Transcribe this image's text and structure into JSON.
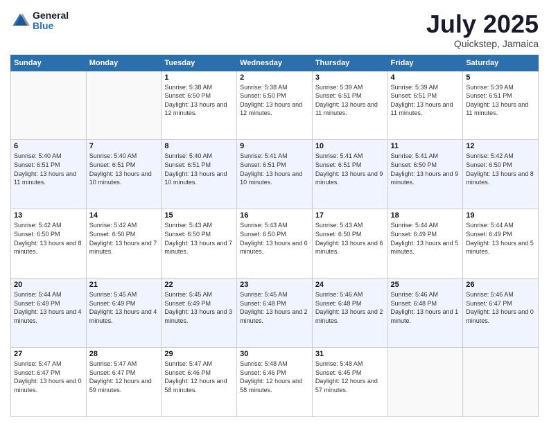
{
  "logo": {
    "text_general": "General",
    "text_blue": "Blue"
  },
  "header": {
    "month": "July 2025",
    "location": "Quickstep, Jamaica"
  },
  "weekdays": [
    "Sunday",
    "Monday",
    "Tuesday",
    "Wednesday",
    "Thursday",
    "Friday",
    "Saturday"
  ],
  "weeks": [
    [
      {
        "day": "",
        "sunrise": "",
        "sunset": "",
        "daylight": ""
      },
      {
        "day": "",
        "sunrise": "",
        "sunset": "",
        "daylight": ""
      },
      {
        "day": "1",
        "sunrise": "Sunrise: 5:38 AM",
        "sunset": "Sunset: 6:50 PM",
        "daylight": "Daylight: 13 hours and 12 minutes."
      },
      {
        "day": "2",
        "sunrise": "Sunrise: 5:38 AM",
        "sunset": "Sunset: 6:50 PM",
        "daylight": "Daylight: 13 hours and 12 minutes."
      },
      {
        "day": "3",
        "sunrise": "Sunrise: 5:39 AM",
        "sunset": "Sunset: 6:51 PM",
        "daylight": "Daylight: 13 hours and 11 minutes."
      },
      {
        "day": "4",
        "sunrise": "Sunrise: 5:39 AM",
        "sunset": "Sunset: 6:51 PM",
        "daylight": "Daylight: 13 hours and 11 minutes."
      },
      {
        "day": "5",
        "sunrise": "Sunrise: 5:39 AM",
        "sunset": "Sunset: 6:51 PM",
        "daylight": "Daylight: 13 hours and 11 minutes."
      }
    ],
    [
      {
        "day": "6",
        "sunrise": "Sunrise: 5:40 AM",
        "sunset": "Sunset: 6:51 PM",
        "daylight": "Daylight: 13 hours and 11 minutes."
      },
      {
        "day": "7",
        "sunrise": "Sunrise: 5:40 AM",
        "sunset": "Sunset: 6:51 PM",
        "daylight": "Daylight: 13 hours and 10 minutes."
      },
      {
        "day": "8",
        "sunrise": "Sunrise: 5:40 AM",
        "sunset": "Sunset: 6:51 PM",
        "daylight": "Daylight: 13 hours and 10 minutes."
      },
      {
        "day": "9",
        "sunrise": "Sunrise: 5:41 AM",
        "sunset": "Sunset: 6:51 PM",
        "daylight": "Daylight: 13 hours and 10 minutes."
      },
      {
        "day": "10",
        "sunrise": "Sunrise: 5:41 AM",
        "sunset": "Sunset: 6:51 PM",
        "daylight": "Daylight: 13 hours and 9 minutes."
      },
      {
        "day": "11",
        "sunrise": "Sunrise: 5:41 AM",
        "sunset": "Sunset: 6:50 PM",
        "daylight": "Daylight: 13 hours and 9 minutes."
      },
      {
        "day": "12",
        "sunrise": "Sunrise: 5:42 AM",
        "sunset": "Sunset: 6:50 PM",
        "daylight": "Daylight: 13 hours and 8 minutes."
      }
    ],
    [
      {
        "day": "13",
        "sunrise": "Sunrise: 5:42 AM",
        "sunset": "Sunset: 6:50 PM",
        "daylight": "Daylight: 13 hours and 8 minutes."
      },
      {
        "day": "14",
        "sunrise": "Sunrise: 5:42 AM",
        "sunset": "Sunset: 6:50 PM",
        "daylight": "Daylight: 13 hours and 7 minutes."
      },
      {
        "day": "15",
        "sunrise": "Sunrise: 5:43 AM",
        "sunset": "Sunset: 6:50 PM",
        "daylight": "Daylight: 13 hours and 7 minutes."
      },
      {
        "day": "16",
        "sunrise": "Sunrise: 5:43 AM",
        "sunset": "Sunset: 6:50 PM",
        "daylight": "Daylight: 13 hours and 6 minutes."
      },
      {
        "day": "17",
        "sunrise": "Sunrise: 5:43 AM",
        "sunset": "Sunset: 6:50 PM",
        "daylight": "Daylight: 13 hours and 6 minutes."
      },
      {
        "day": "18",
        "sunrise": "Sunrise: 5:44 AM",
        "sunset": "Sunset: 6:49 PM",
        "daylight": "Daylight: 13 hours and 5 minutes."
      },
      {
        "day": "19",
        "sunrise": "Sunrise: 5:44 AM",
        "sunset": "Sunset: 6:49 PM",
        "daylight": "Daylight: 13 hours and 5 minutes."
      }
    ],
    [
      {
        "day": "20",
        "sunrise": "Sunrise: 5:44 AM",
        "sunset": "Sunset: 6:49 PM",
        "daylight": "Daylight: 13 hours and 4 minutes."
      },
      {
        "day": "21",
        "sunrise": "Sunrise: 5:45 AM",
        "sunset": "Sunset: 6:49 PM",
        "daylight": "Daylight: 13 hours and 4 minutes."
      },
      {
        "day": "22",
        "sunrise": "Sunrise: 5:45 AM",
        "sunset": "Sunset: 6:49 PM",
        "daylight": "Daylight: 13 hours and 3 minutes."
      },
      {
        "day": "23",
        "sunrise": "Sunrise: 5:45 AM",
        "sunset": "Sunset: 6:48 PM",
        "daylight": "Daylight: 13 hours and 2 minutes."
      },
      {
        "day": "24",
        "sunrise": "Sunrise: 5:46 AM",
        "sunset": "Sunset: 6:48 PM",
        "daylight": "Daylight: 13 hours and 2 minutes."
      },
      {
        "day": "25",
        "sunrise": "Sunrise: 5:46 AM",
        "sunset": "Sunset: 6:48 PM",
        "daylight": "Daylight: 13 hours and 1 minute."
      },
      {
        "day": "26",
        "sunrise": "Sunrise: 5:46 AM",
        "sunset": "Sunset: 6:47 PM",
        "daylight": "Daylight: 13 hours and 0 minutes."
      }
    ],
    [
      {
        "day": "27",
        "sunrise": "Sunrise: 5:47 AM",
        "sunset": "Sunset: 6:47 PM",
        "daylight": "Daylight: 13 hours and 0 minutes."
      },
      {
        "day": "28",
        "sunrise": "Sunrise: 5:47 AM",
        "sunset": "Sunset: 6:47 PM",
        "daylight": "Daylight: 12 hours and 59 minutes."
      },
      {
        "day": "29",
        "sunrise": "Sunrise: 5:47 AM",
        "sunset": "Sunset: 6:46 PM",
        "daylight": "Daylight: 12 hours and 58 minutes."
      },
      {
        "day": "30",
        "sunrise": "Sunrise: 5:48 AM",
        "sunset": "Sunset: 6:46 PM",
        "daylight": "Daylight: 12 hours and 58 minutes."
      },
      {
        "day": "31",
        "sunrise": "Sunrise: 5:48 AM",
        "sunset": "Sunset: 6:45 PM",
        "daylight": "Daylight: 12 hours and 57 minutes."
      },
      {
        "day": "",
        "sunrise": "",
        "sunset": "",
        "daylight": ""
      },
      {
        "day": "",
        "sunrise": "",
        "sunset": "",
        "daylight": ""
      }
    ]
  ]
}
